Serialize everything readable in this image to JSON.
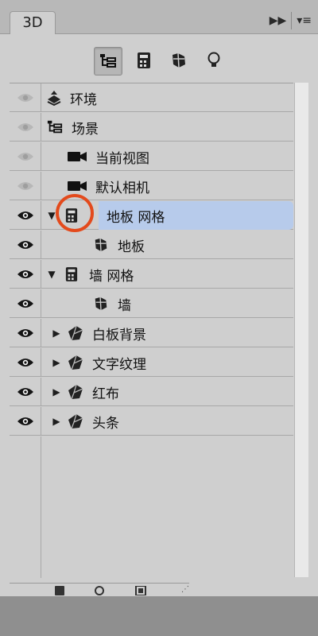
{
  "panel": {
    "tab_label": "3D"
  },
  "toolbar": {
    "buttons": [
      {
        "name": "scene-filter",
        "active": true
      },
      {
        "name": "meshes-filter",
        "active": false
      },
      {
        "name": "materials-filter",
        "active": false
      },
      {
        "name": "lights-filter",
        "active": false
      }
    ]
  },
  "layers": [
    {
      "label": "环境",
      "icon": "environment-icon",
      "indent": 0,
      "expand": "none",
      "eye": "dim"
    },
    {
      "label": "场景",
      "icon": "scene-icon",
      "indent": 0,
      "expand": "none",
      "eye": "dim"
    },
    {
      "label": "当前视图",
      "icon": "camera-icon",
      "indent": 1,
      "expand": "none",
      "eye": "dim"
    },
    {
      "label": "默认相机",
      "icon": "camera-icon",
      "indent": 1,
      "expand": "none",
      "eye": "dim"
    },
    {
      "label": "地板 网格",
      "icon": "mesh-icon",
      "indent": 1,
      "expand": "open",
      "eye": "on",
      "selected": true
    },
    {
      "label": "地板",
      "icon": "material-icon",
      "indent": 2,
      "expand": "none",
      "eye": "on"
    },
    {
      "label": "墙 网格",
      "icon": "mesh-icon",
      "indent": 1,
      "expand": "open",
      "eye": "on"
    },
    {
      "label": "墙",
      "icon": "material-icon",
      "indent": 2,
      "expand": "none",
      "eye": "on"
    },
    {
      "label": "白板背景",
      "icon": "object-icon",
      "indent": 1,
      "expand": "closed",
      "eye": "on"
    },
    {
      "label": "文字纹理",
      "icon": "object-icon",
      "indent": 1,
      "expand": "closed",
      "eye": "on"
    },
    {
      "label": "红布",
      "icon": "object-icon",
      "indent": 1,
      "expand": "closed",
      "eye": "on"
    },
    {
      "label": "头条",
      "icon": "object-icon",
      "indent": 1,
      "expand": "closed",
      "eye": "on"
    }
  ],
  "colors": {
    "selection": "#b7cbeb",
    "annotation_circle": "#e34a1c"
  }
}
